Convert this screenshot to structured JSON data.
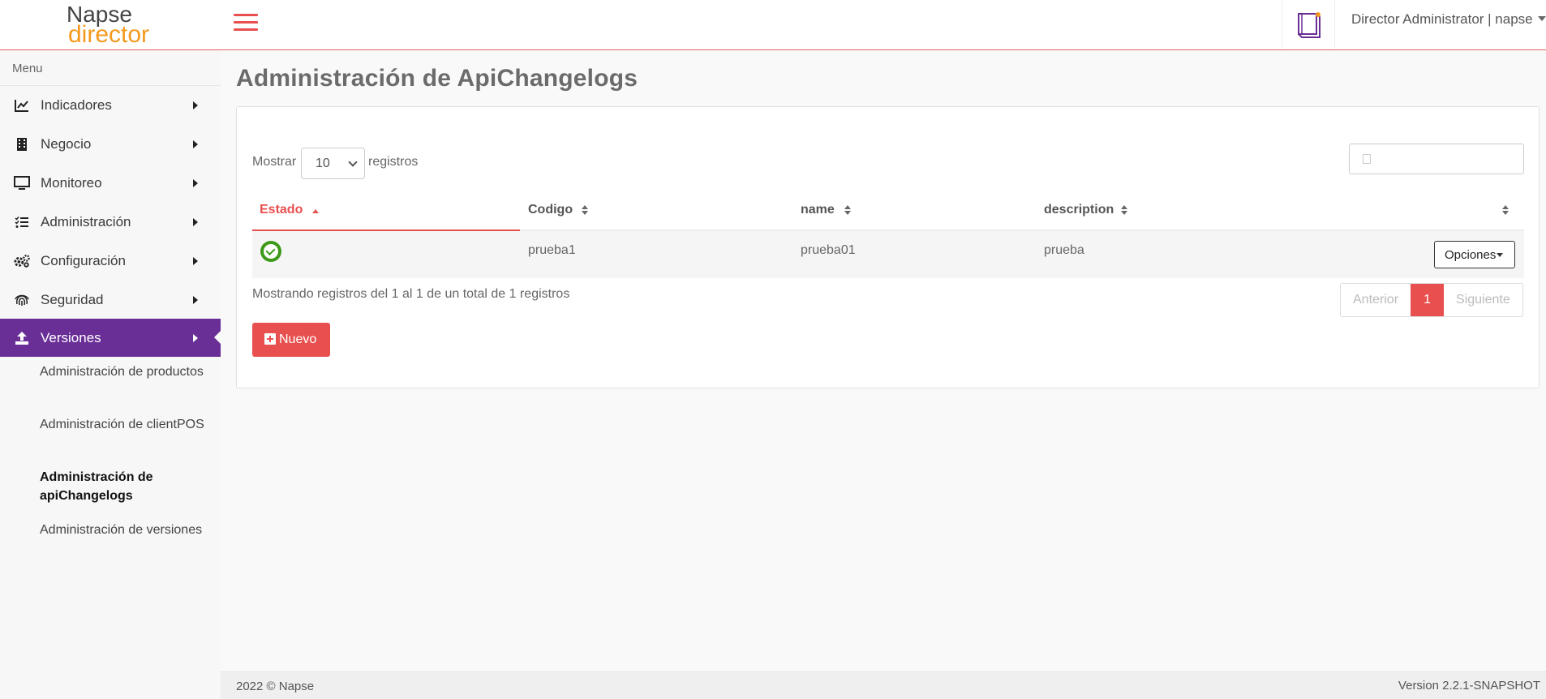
{
  "header": {
    "logo_top": "Napse",
    "logo_bottom": "director",
    "user_label": "Director Administrator | napse"
  },
  "sidebar": {
    "title": "Menu",
    "items": [
      {
        "label": "Indicadores",
        "icon": "chart-line-icon"
      },
      {
        "label": "Negocio",
        "icon": "building-icon"
      },
      {
        "label": "Monitoreo",
        "icon": "monitor-icon"
      },
      {
        "label": "Administración",
        "icon": "list-check-icon"
      },
      {
        "label": "Configuración",
        "icon": "gears-icon"
      },
      {
        "label": "Seguridad",
        "icon": "fingerprint-icon"
      },
      {
        "label": "Versiones",
        "icon": "upload-icon",
        "active": true
      }
    ],
    "subitems": [
      {
        "label": "Administración de productos"
      },
      {
        "label": "Administración de clientPOS"
      },
      {
        "label": "Administración de apiChangelogs",
        "current": true
      },
      {
        "label": "Administración de versiones"
      }
    ]
  },
  "main": {
    "title": "Administración de ApiChangelogs",
    "length": {
      "prefix": "Mostrar",
      "value": "10",
      "suffix": "registros"
    },
    "search": {
      "placeholder": ""
    },
    "table": {
      "columns": [
        "Estado",
        "Codigo",
        "name",
        "description"
      ],
      "rows": [
        {
          "estado": "active",
          "codigo": "prueba1",
          "name": "prueba01",
          "description": "prueba",
          "action": "Opciones"
        }
      ]
    },
    "info": "Mostrando registros del 1 al 1 de un total de 1 registros",
    "pagination": {
      "prev": "Anterior",
      "current": "1",
      "next": "Siguiente"
    },
    "new_button": "Nuevo"
  },
  "footer": {
    "copyright": "2022 © Napse",
    "version": "Version 2.2.1-SNAPSHOT"
  },
  "colors": {
    "accent": "#e8504f",
    "active_nav": "#6a2f97",
    "logo_orange": "#f39a1e",
    "status_green": "#3c9a18"
  }
}
